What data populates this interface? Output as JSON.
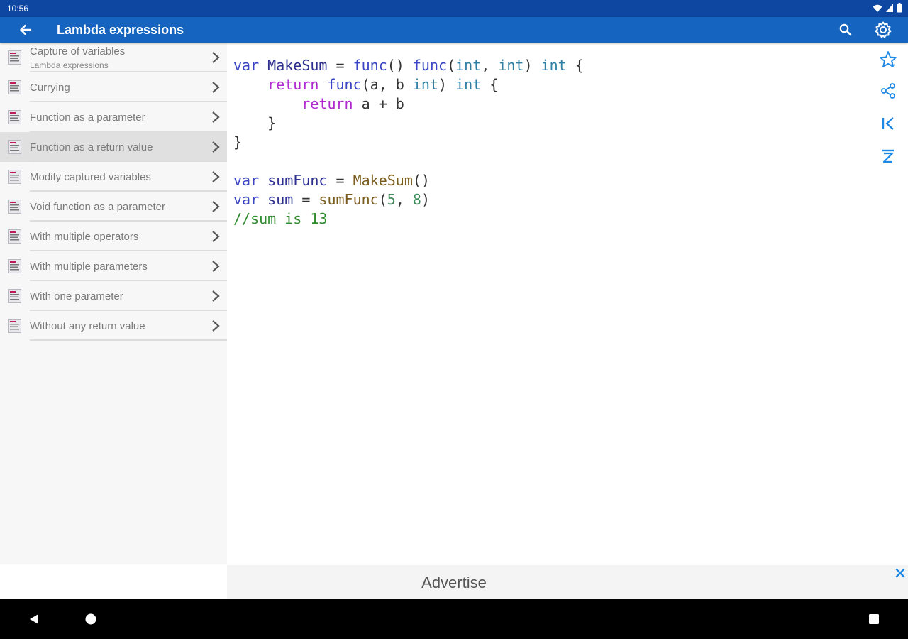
{
  "status_bar": {
    "time": "10:56"
  },
  "app_bar": {
    "title": "Lambda expressions"
  },
  "sidebar": {
    "items": [
      {
        "label": "Capture of variables",
        "sublabel": "Lambda expressions",
        "selected": false
      },
      {
        "label": "Currying",
        "selected": false
      },
      {
        "label": "Function as a parameter",
        "selected": false
      },
      {
        "label": "Function as a return value",
        "selected": true
      },
      {
        "label": "Modify captured variables",
        "selected": false
      },
      {
        "label": "Void function as a parameter",
        "selected": false
      },
      {
        "label": "With multiple operators",
        "selected": false
      },
      {
        "label": "With multiple parameters",
        "selected": false
      },
      {
        "label": "With one parameter",
        "selected": false
      },
      {
        "label": "Without any return value",
        "selected": false
      }
    ]
  },
  "code": {
    "lines": [
      [
        [
          "kw",
          "var"
        ],
        [
          "pl",
          " "
        ],
        [
          "id",
          "MakeSum"
        ],
        [
          "pl",
          " = "
        ],
        [
          "kw",
          "func"
        ],
        [
          "pl",
          "() "
        ],
        [
          "kw",
          "func"
        ],
        [
          "pl",
          "("
        ],
        [
          "ty",
          "int"
        ],
        [
          "pl",
          ", "
        ],
        [
          "ty",
          "int"
        ],
        [
          "pl",
          ") "
        ],
        [
          "ty",
          "int"
        ],
        [
          "pl",
          " {"
        ]
      ],
      [
        [
          "pl",
          "    "
        ],
        [
          "rt",
          "return"
        ],
        [
          "pl",
          " "
        ],
        [
          "kw",
          "func"
        ],
        [
          "pl",
          "(a, b "
        ],
        [
          "ty",
          "int"
        ],
        [
          "pl",
          ") "
        ],
        [
          "ty",
          "int"
        ],
        [
          "pl",
          " {"
        ]
      ],
      [
        [
          "pl",
          "        "
        ],
        [
          "rt",
          "return"
        ],
        [
          "pl",
          " a + b"
        ]
      ],
      [
        [
          "pl",
          "    }"
        ]
      ],
      [
        [
          "pl",
          "}"
        ]
      ],
      [
        [
          "pl",
          ""
        ]
      ],
      [
        [
          "kw",
          "var"
        ],
        [
          "pl",
          " "
        ],
        [
          "id",
          "sumFunc"
        ],
        [
          "pl",
          " = "
        ],
        [
          "fn",
          "MakeSum"
        ],
        [
          "pl",
          "()"
        ]
      ],
      [
        [
          "kw",
          "var"
        ],
        [
          "pl",
          " "
        ],
        [
          "id",
          "sum"
        ],
        [
          "pl",
          " = "
        ],
        [
          "fn",
          "sumFunc"
        ],
        [
          "pl",
          "("
        ],
        [
          "num",
          "5"
        ],
        [
          "pl",
          ", "
        ],
        [
          "num",
          "8"
        ],
        [
          "pl",
          ")"
        ]
      ],
      [
        [
          "cm",
          "//sum is 13"
        ]
      ]
    ]
  },
  "ad_bar": {
    "text": "Advertise"
  },
  "icons": {
    "back": "arrow-back-icon",
    "search": "search-icon",
    "settings": "gear-icon",
    "favorite": "star-icon",
    "share": "share-icon",
    "first": "first-page-icon",
    "last": "last-page-icon",
    "ad_close": "close-icon"
  },
  "colors": {
    "app_bar": "#1565c0",
    "status_bar": "#0d47a1",
    "accent": "#1e88e5"
  }
}
